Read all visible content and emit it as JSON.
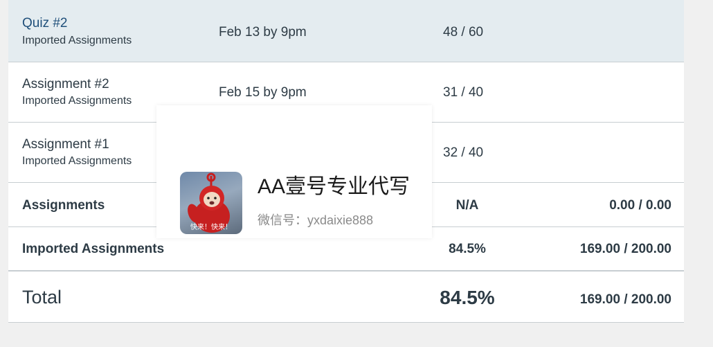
{
  "assignments": [
    {
      "title": "Quiz #2",
      "group": "Imported Assignments",
      "due": "Feb 13 by 9pm",
      "score": "48 / 60"
    },
    {
      "title": "Assignment #2",
      "group": "Imported Assignments",
      "due": "Feb 15 by 9pm",
      "score": "31 / 40"
    },
    {
      "title": "Assignment #1",
      "group": "Imported Assignments",
      "due": "",
      "score": "32 / 40"
    }
  ],
  "groups": [
    {
      "name": "Assignments",
      "percent": "N/A",
      "points": "0.00 / 0.00"
    },
    {
      "name": "Imported Assignments",
      "percent": "84.5%",
      "points": "169.00 / 200.00"
    }
  ],
  "total": {
    "label": "Total",
    "percent": "84.5%",
    "points": "169.00 / 200.00"
  },
  "watermark": {
    "title": "AA壹号专业代写",
    "subtitle": "微信号：yxdaixie888",
    "avatar_caption": "快来！快来！"
  },
  "colors": {
    "highlight_row": "#e4ecf0",
    "text": "#2d3b45",
    "link": "#1f4f7a",
    "divider": "#c7cdd1",
    "background": "#f0f0f0"
  }
}
